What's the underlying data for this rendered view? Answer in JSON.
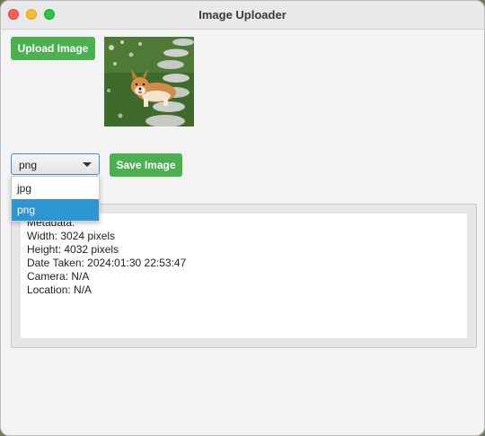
{
  "window": {
    "title": "Image Uploader"
  },
  "toolbar": {
    "upload_label": "Upload Image",
    "save_label": "Save Image"
  },
  "format_select": {
    "selected": "png",
    "options": [
      "jpg",
      "png"
    ]
  },
  "metadata": {
    "lines": [
      "Metadata:",
      "Width: 3024 pixels",
      "Height: 4032 pixels",
      "Date Taken: 2024:01:30 22:53:47",
      "Camera: N/A",
      "Location: N/A"
    ]
  },
  "colors": {
    "button_green": "#4caf50",
    "selection_blue": "#2e95d3",
    "focus_blue": "#3d8fd6"
  },
  "icons": {
    "window_controls": [
      "close-icon",
      "minimize-icon",
      "maximize-icon"
    ],
    "dropdown": "chevron-down-icon"
  }
}
